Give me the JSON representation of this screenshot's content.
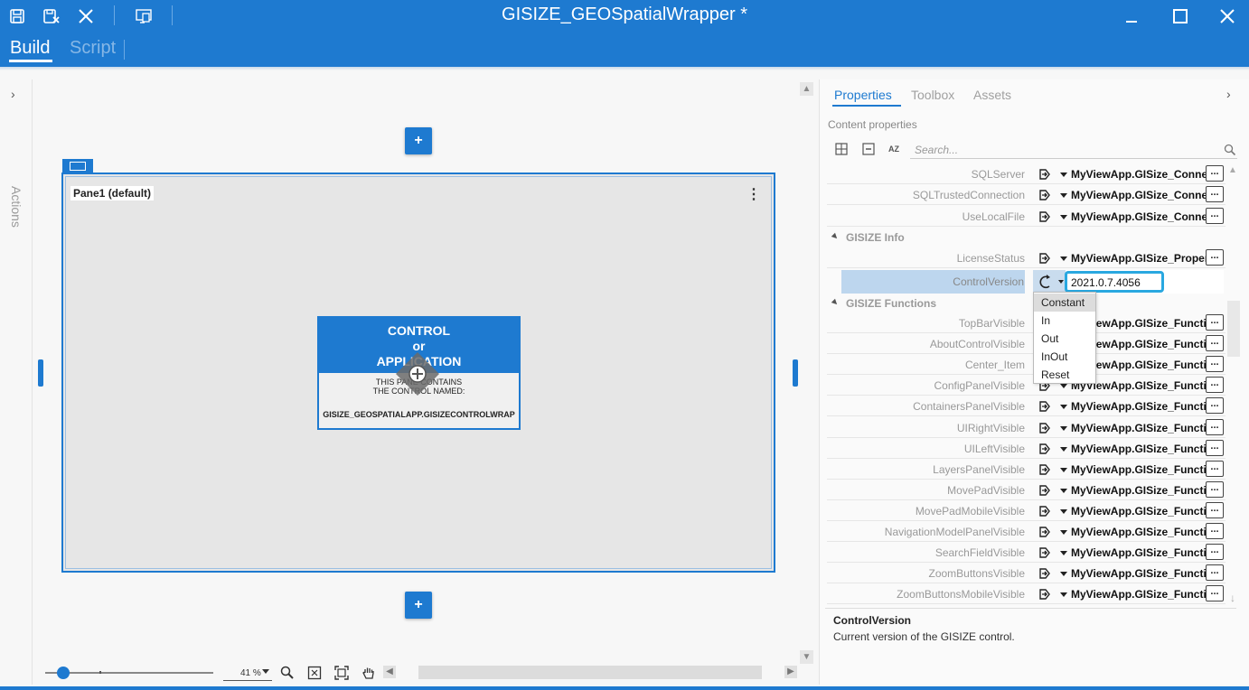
{
  "window": {
    "title": "GISIZE_GEOSpatialWrapper *",
    "accent_color": "#1e7ad0"
  },
  "toolbar": {
    "icons": [
      "save-icon",
      "save-close-icon",
      "close-icon",
      "preview-icon"
    ]
  },
  "tabs": {
    "build": "Build",
    "script": "Script"
  },
  "actions_panel": {
    "label": "Actions"
  },
  "canvas": {
    "pane_label": "Pane1 (default)",
    "add_symbol": "+",
    "control": {
      "heading_line1": "CONTROL",
      "heading_line2": "or",
      "heading_line3": "APPLICATION",
      "contains_line1": "THIS PANE CONTAINS",
      "contains_line2": "THE CONTROL NAMED:",
      "control_name": "GISIZE_GEOSPATIALAPP.GISIZECONTROLWRAP"
    },
    "zoom_value": "41 %"
  },
  "right_panel": {
    "tabs": [
      "Properties",
      "Toolbox",
      "Assets"
    ],
    "content_properties": "Content properties",
    "search_placeholder": "Search...",
    "sort_az": "AZ",
    "rows_top": [
      {
        "name": "SQLServer",
        "value": "MyViewApp.GISize_Connection"
      },
      {
        "name": "SQLTrustedConnection",
        "value": "MyViewApp.GISize_Connection"
      },
      {
        "name": "UseLocalFile",
        "value": "MyViewApp.GISize_Connection"
      }
    ],
    "category_info": "GISIZE Info",
    "row_license": {
      "name": "LicenseStatus",
      "value": "MyViewApp.GISize_Properties"
    },
    "selected_row": {
      "name": "ControlVersion",
      "value": "2021.0.7.4056"
    },
    "category_functions": "GISIZE Functions",
    "dropdown_options": [
      "Constant",
      "In",
      "Out",
      "InOut",
      "Reset"
    ],
    "rows_functions": [
      {
        "name": "TopBarVisible",
        "value": "MyViewApp.GISize_Functions"
      },
      {
        "name": "AboutControlVisible",
        "value": "MyViewApp.GISize_Functions"
      },
      {
        "name": "Center_Item",
        "value": "MyViewApp.GISize_Functions"
      },
      {
        "name": "ConfigPanelVisible",
        "value": "MyViewApp.GISize_Functions"
      },
      {
        "name": "ContainersPanelVisible",
        "value": "MyViewApp.GISize_Functions"
      },
      {
        "name": "UIRightVisible",
        "value": "MyViewApp.GISize_Functions"
      },
      {
        "name": "UILeftVisible",
        "value": "MyViewApp.GISize_Functions"
      },
      {
        "name": "LayersPanelVisible",
        "value": "MyViewApp.GISize_Functions"
      },
      {
        "name": "MovePadVisible",
        "value": "MyViewApp.GISize_Functions"
      },
      {
        "name": "MovePadMobileVisible",
        "value": "MyViewApp.GISize_Functions"
      },
      {
        "name": "NavigationModelPanelVisible",
        "value": "MyViewApp.GISize_Functions"
      },
      {
        "name": "SearchFieldVisible",
        "value": "MyViewApp.GISize_Functions"
      },
      {
        "name": "ZoomButtonsVisible",
        "value": "MyViewApp.GISize_Functions"
      },
      {
        "name": "ZoomButtonsMobileVisible",
        "value": "MyViewApp.GISize_Functions"
      }
    ],
    "ellipsis": "...",
    "description": {
      "title": "ControlVersion",
      "text": "Current version of the GISIZE control."
    }
  }
}
